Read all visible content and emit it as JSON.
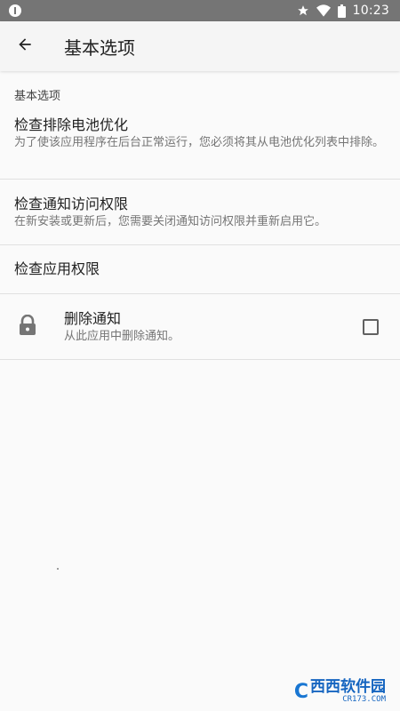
{
  "status_bar": {
    "time": "10:23",
    "icons": [
      "notification-icon",
      "star-icon",
      "wifi-icon",
      "battery-icon"
    ]
  },
  "app_bar": {
    "title": "基本选项",
    "back_icon": "arrow-back-icon"
  },
  "section": {
    "header": "基本选项"
  },
  "preferences": [
    {
      "title": "检查排除电池优化",
      "summary": "为了使该应用程序在后台正常运行，您必须将其从电池优化列表中排除。"
    },
    {
      "title": "检查通知访问权限",
      "summary": "在新安装或更新后，您需要关闭通知访问权限并重新启用它。"
    },
    {
      "title": "检查应用权限"
    },
    {
      "title": "删除通知",
      "summary": "从此应用中删除通知。",
      "icon": "lock-icon",
      "checked": false
    }
  ],
  "watermark": {
    "logo": "C",
    "brand": "西西软件园",
    "url": "CR173.COM"
  },
  "colors": {
    "status_bar_bg": "#757575",
    "app_bar_bg": "#f5f5f5",
    "background": "#fafafa",
    "watermark_blue": "#1565c0"
  }
}
